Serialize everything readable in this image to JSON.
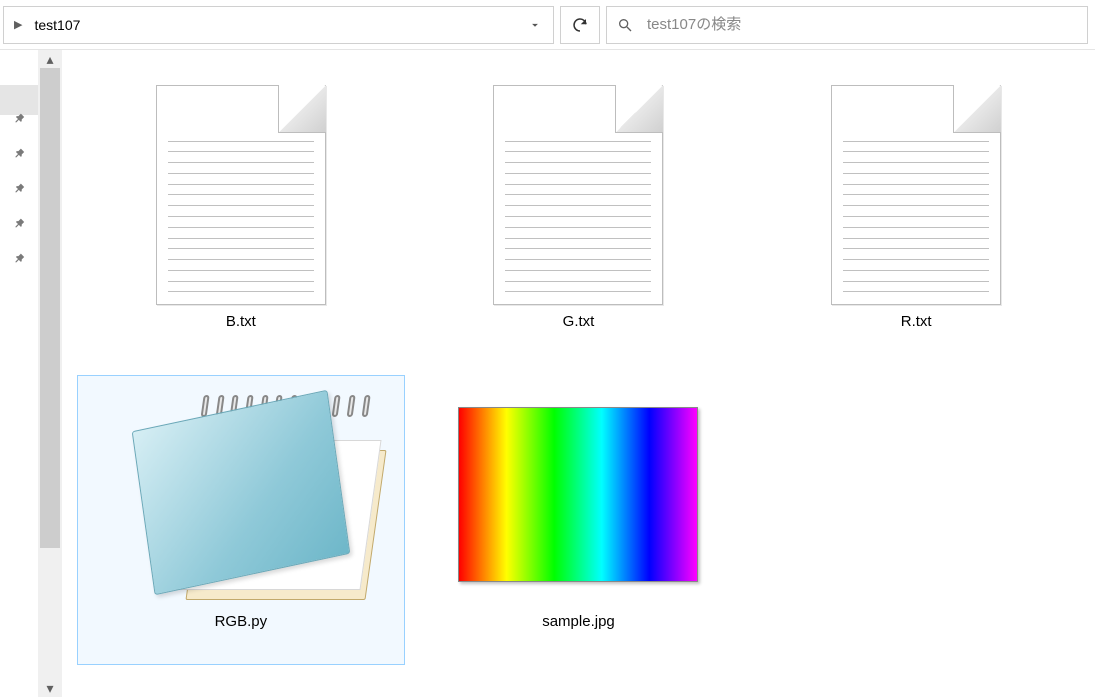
{
  "breadcrumb": {
    "current": "test107"
  },
  "search": {
    "placeholder": "test107の検索"
  },
  "files": [
    {
      "name": "B.txt",
      "kind": "text",
      "selected": false
    },
    {
      "name": "G.txt",
      "kind": "text",
      "selected": false
    },
    {
      "name": "R.txt",
      "kind": "text",
      "selected": false
    },
    {
      "name": "RGB.py",
      "kind": "notepad",
      "selected": true
    },
    {
      "name": "sample.jpg",
      "kind": "image",
      "selected": false
    }
  ]
}
